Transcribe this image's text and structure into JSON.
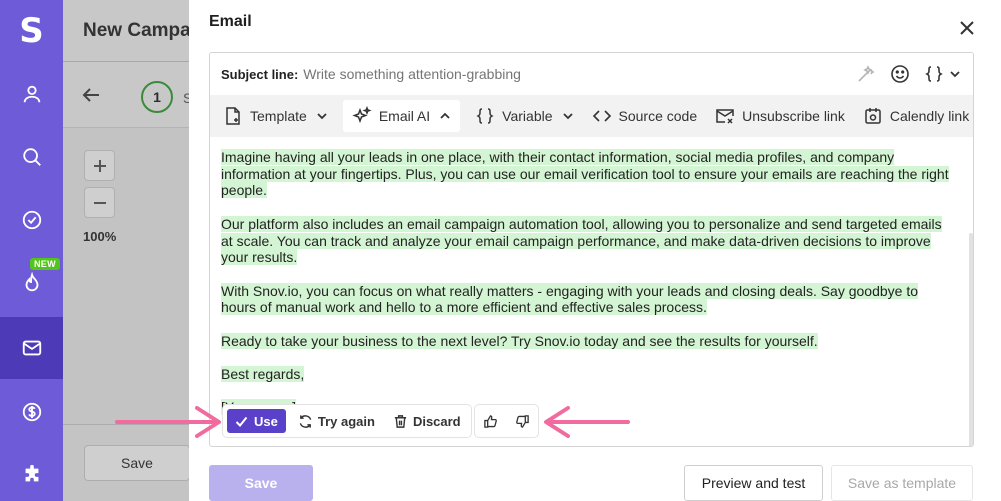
{
  "sidebar": {
    "logo": "S",
    "items": [
      {
        "icon": "user-icon"
      },
      {
        "icon": "search-icon"
      },
      {
        "icon": "check-circle-icon"
      },
      {
        "icon": "flame-icon",
        "badge": "NEW"
      },
      {
        "icon": "mail-icon",
        "active": true
      },
      {
        "icon": "dollar-icon"
      },
      {
        "icon": "puzzle-icon"
      }
    ],
    "accent": "#6d5bd8",
    "active_bg": "#4d3ab6"
  },
  "background": {
    "title": "New Campai",
    "step_number": "1",
    "step_label": "S",
    "zoom_label": "100%",
    "save_label": "Save"
  },
  "modal": {
    "title": "Email",
    "subject": {
      "label": "Subject line:",
      "placeholder": "Write something attention-grabbing"
    },
    "toolbar": {
      "template": "Template",
      "email_ai": "Email AI",
      "variable": "Variable",
      "source_code": "Source code",
      "unsubscribe": "Unsubscribe link",
      "calendly": "Calendly link"
    },
    "body_paragraphs": [
      "Imagine having all your leads in one place, with their contact information, social media profiles, and company information at your fingertips. Plus, you can use our email verification tool to ensure your emails are reaching the right people.",
      "Our platform also includes an email campaign automation tool, allowing you to personalize and send targeted emails at scale. You can track and analyze your email campaign performance, and make data-driven decisions to improve your results.",
      "With Snov.io, you can focus on what really matters - engaging with your leads and closing deals. Say goodbye to hours of manual work and hello to a more efficient and effective sales process.",
      "Ready to take your business to the next level? Try Snov.io today and see the results for yourself.",
      "Best regards,",
      "[Your name]"
    ],
    "ai_actions": {
      "use": "Use",
      "try_again": "Try again",
      "discard": "Discard"
    },
    "footer": {
      "save": "Save",
      "preview": "Preview and test",
      "save_template": "Save as template"
    }
  },
  "colors": {
    "highlight": "#d4f5d3",
    "primary": "#5b41c9",
    "arrow": "#f06b9e"
  }
}
